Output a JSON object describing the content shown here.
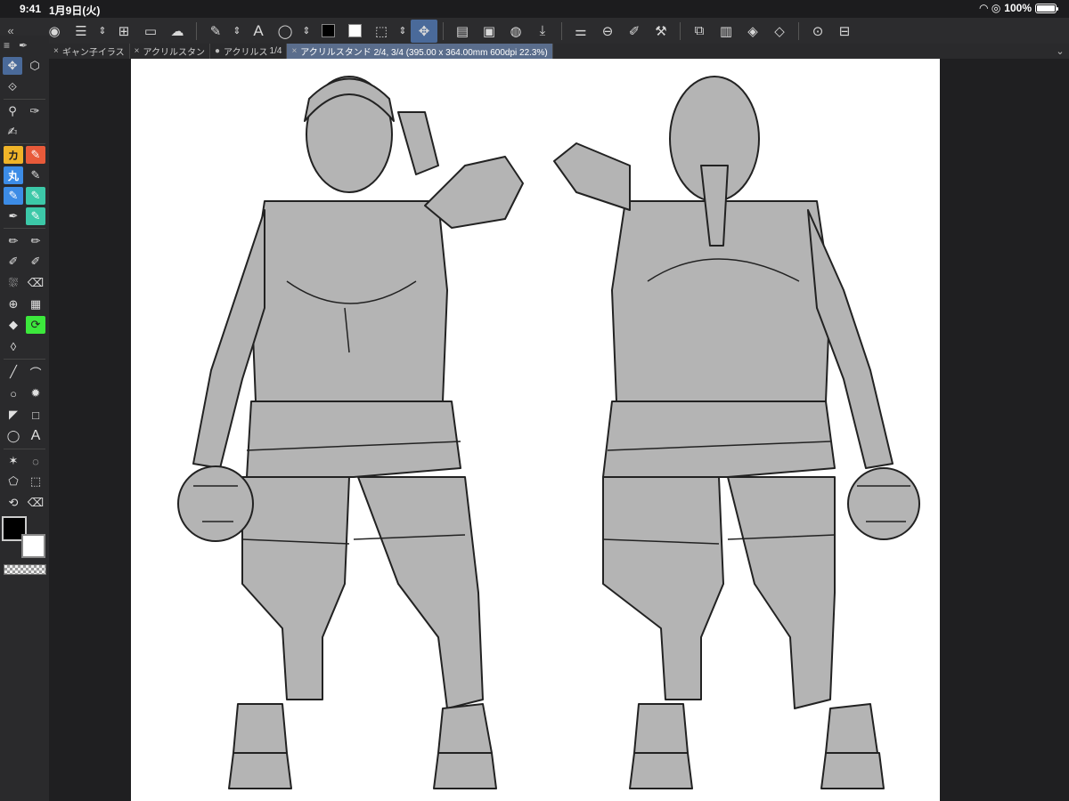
{
  "status": {
    "time": "9:41",
    "date": "1月9日(火)",
    "battery": "100%"
  },
  "toolbar": {
    "collapse": "«",
    "text_tool_label": "A",
    "icons": [
      "app-logo-icon",
      "menu-icon",
      "stepper-icon",
      "new-icon",
      "open-icon",
      "save-cloud-icon",
      "brush-icon",
      "stepper-icon",
      "text-icon",
      "lasso-icon",
      "stepper-icon",
      "black-swatch",
      "white-swatch",
      "transform-icon",
      "stepper-icon",
      "move-icon",
      "layer-property-icon",
      "canvas-icon",
      "material-icon",
      "export-icon",
      "adjust-icon",
      "link-icon",
      "pen-settings-icon",
      "wrench-icon",
      "companion-icon",
      "layers-icon",
      "layer-stack-icon",
      "layer-group-icon",
      "zoom-icon",
      "snap-icon"
    ]
  },
  "tabs": [
    {
      "close": "×",
      "label": "ギャン子イラス"
    },
    {
      "close": "×",
      "label": "アクリルスタン"
    },
    {
      "close": "●",
      "label": "アクリルス"
    },
    {
      "close": "",
      "label": "1/4"
    },
    {
      "close": "×",
      "label": "アクリルスタンド 2/4, 3/4 (395.00 x 364.00mm 600dpi 22.3%)"
    }
  ],
  "palette": {
    "kana1": "カ",
    "kana2": "丸",
    "text_tool": "A"
  },
  "colors": {
    "main": "#000000",
    "sub": "#ffffff",
    "fill_gray": "#b4b4b4",
    "accent": "#4a6a9a"
  }
}
